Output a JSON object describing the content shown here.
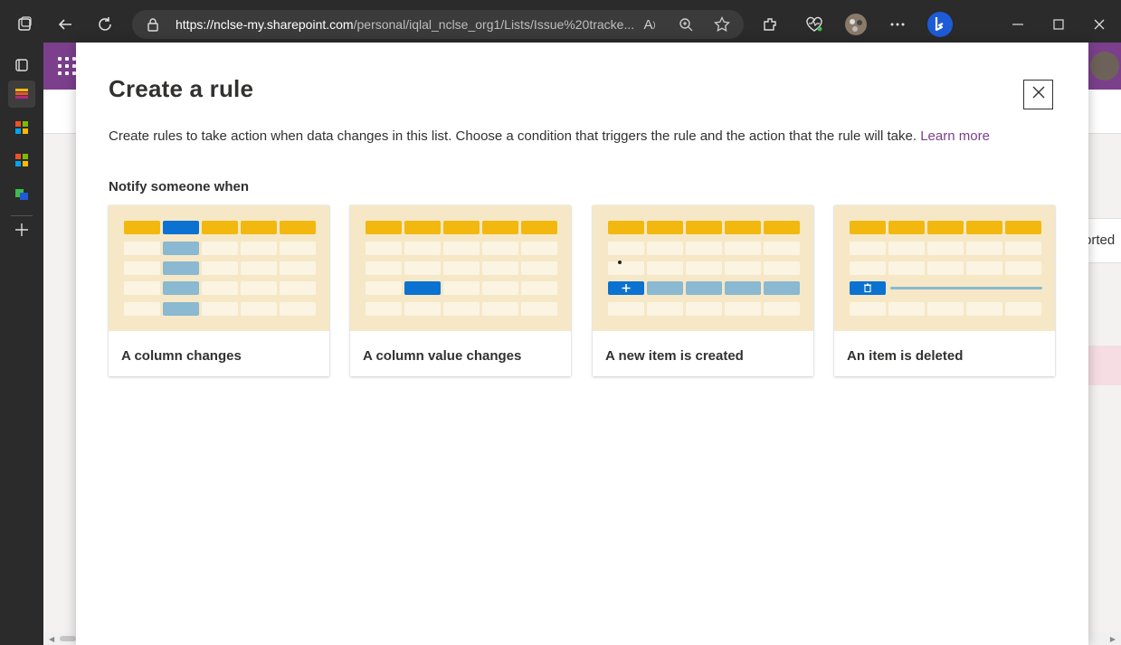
{
  "browser": {
    "url_host": "https://nclse-my.sharepoint.com",
    "url_path": "/personal/iqlal_nclse_org1/Lists/Issue%20tracke..."
  },
  "background_page": {
    "partial_text": "orted"
  },
  "modal": {
    "title": "Create a rule",
    "description": "Create rules to take action when data changes in this list. Choose a condition that triggers the rule and the action that the rule will take.",
    "learn_more": "Learn more",
    "section_title": "Notify someone when",
    "cards": [
      {
        "label": "A column changes",
        "illustration": "column-highlight"
      },
      {
        "label": "A column value changes",
        "illustration": "cell-highlight"
      },
      {
        "label": "A new item is created",
        "illustration": "add-row"
      },
      {
        "label": "An item is deleted",
        "illustration": "delete-row"
      }
    ]
  },
  "colors": {
    "accent_purple": "#7b3f8c",
    "header_yellow": "#f2b80f",
    "highlight_blue": "#0b72d1",
    "muted_blue": "#8ab9d1",
    "card_bg": "#f6e8c6",
    "cell_bg": "#fbf4e3"
  },
  "icons": [
    "tabs-icon",
    "back-icon",
    "refresh-icon",
    "lock-icon",
    "read-aloud-icon",
    "zoom-icon",
    "favorite-icon",
    "extensions-icon",
    "health-icon",
    "profile-avatar",
    "more-icon",
    "bing-icon",
    "minimize-icon",
    "maximize-icon",
    "close-window-icon",
    "close-icon"
  ]
}
